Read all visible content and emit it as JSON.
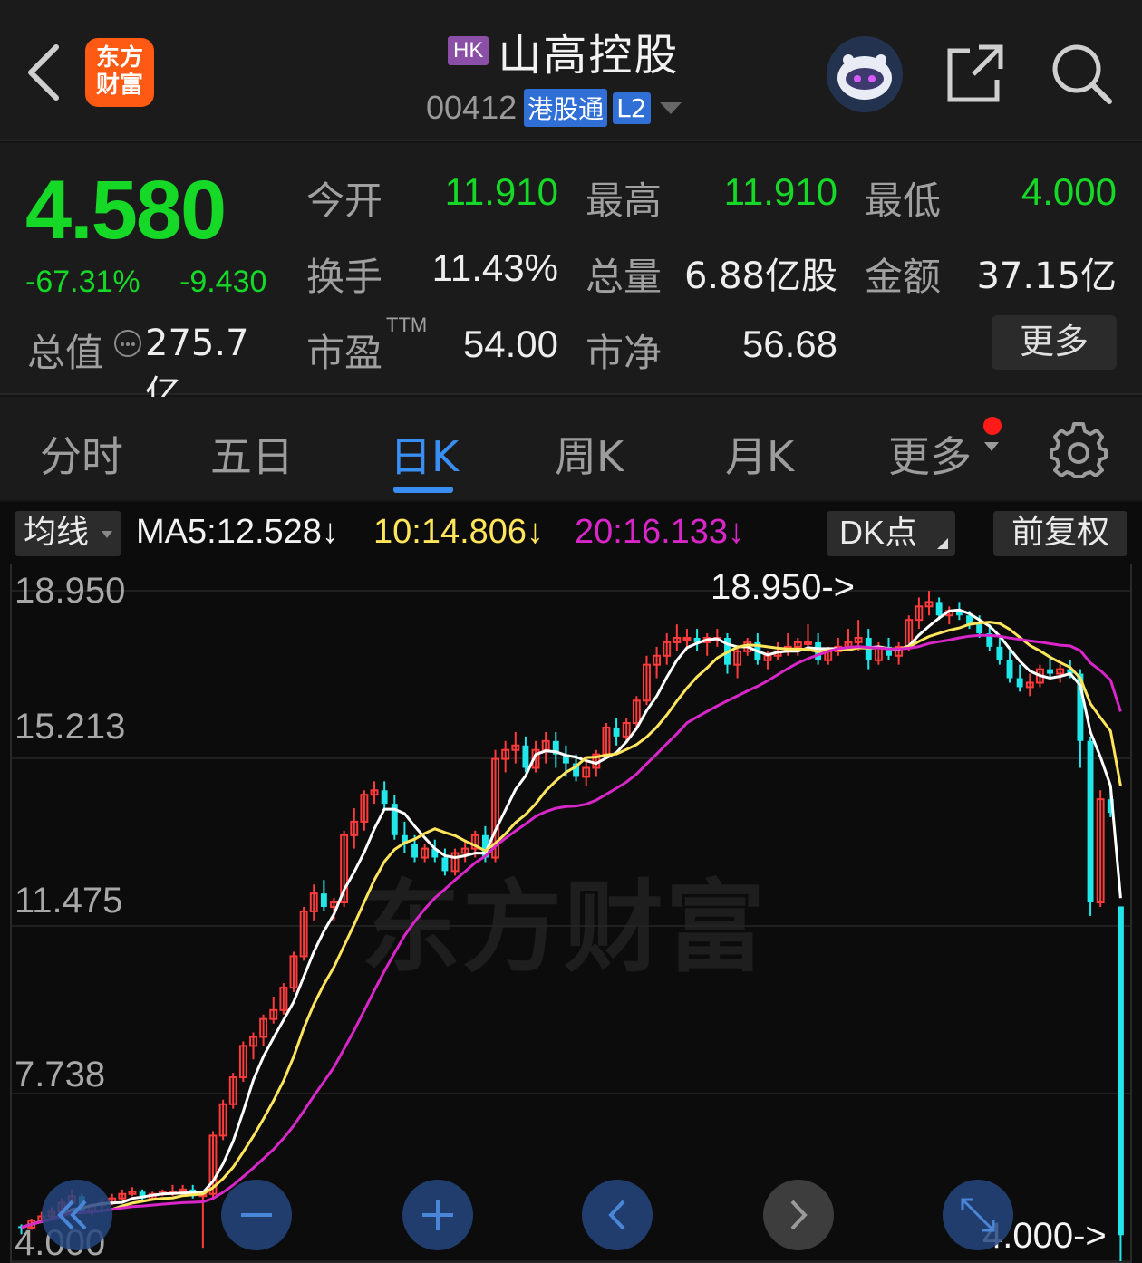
{
  "header": {
    "logo_line1": "东方",
    "logo_line2": "财富",
    "market_badge": "HK",
    "stock_name": "山高控股",
    "stock_code": "00412",
    "connect_badge": "港股通",
    "level_badge": "L2"
  },
  "quote": {
    "price": "4.580",
    "change_pct": "-67.31%",
    "change_val": "-9.430",
    "open_label": "今开",
    "open_value": "11.910",
    "high_label": "最高",
    "high_value": "11.910",
    "low_label": "最低",
    "low_value": "4.000",
    "turnover_label": "换手",
    "turnover_value": "11.43%",
    "volume_label": "总量",
    "volume_value": "6.88亿股",
    "amount_label": "金额",
    "amount_value": "37.15亿",
    "mktcap_label": "总值",
    "mktcap_value": "275.7亿",
    "pe_label": "市盈",
    "pe_sup": "TTM",
    "pe_value": "54.00",
    "pb_label": "市净",
    "pb_value": "56.68",
    "more_label": "更多"
  },
  "tabs": [
    "分时",
    "五日",
    "日K",
    "周K",
    "月K",
    "更多"
  ],
  "chart_toolbar": {
    "ma_select": "均线",
    "ma5": "MA5:12.528↓",
    "ma10": "10:14.806↓",
    "ma20": "20:16.133↓",
    "dk_button": "DK点",
    "adjust_button": "前复权"
  },
  "chart_labels": {
    "y_ticks": [
      "18.950",
      "15.213",
      "11.475",
      "7.738",
      "4.000"
    ],
    "high_marker": "18.950->",
    "low_marker": "4.000->",
    "watermark": "东方财富"
  },
  "colors": {
    "up": "#ff3b3b",
    "down": "#21e6ea",
    "ma5": "#ffffff",
    "ma10": "#ffe55c",
    "ma20": "#d926c9",
    "price_down": "#15d926",
    "accent": "#3a8ff5"
  },
  "controls": [
    "double-left-icon",
    "zoom-out-icon",
    "zoom-in-icon",
    "left-icon",
    "right-icon",
    "expand-icon"
  ],
  "chart_data": {
    "type": "candlestick",
    "ylim": [
      4.0,
      18.95
    ],
    "y_ticks": [
      18.95,
      15.213,
      11.475,
      7.738,
      4.0
    ],
    "candles_ohlc_approx": [
      [
        4.78,
        4.82,
        4.6,
        4.75
      ],
      [
        4.75,
        4.95,
        4.7,
        4.9
      ],
      [
        4.9,
        5.1,
        4.85,
        5.0
      ],
      [
        5.0,
        5.2,
        4.95,
        5.1
      ],
      [
        5.1,
        5.4,
        5.0,
        5.3
      ],
      [
        5.3,
        5.6,
        5.25,
        5.45
      ],
      [
        5.45,
        5.5,
        5.05,
        5.1
      ],
      [
        5.1,
        5.3,
        5.0,
        5.25
      ],
      [
        5.25,
        5.4,
        5.15,
        5.3
      ],
      [
        5.3,
        5.5,
        5.25,
        5.4
      ],
      [
        5.4,
        5.6,
        5.35,
        5.5
      ],
      [
        5.5,
        5.65,
        5.45,
        5.55
      ],
      [
        5.55,
        5.6,
        5.35,
        5.4
      ],
      [
        5.4,
        5.55,
        5.35,
        5.5
      ],
      [
        5.5,
        5.6,
        5.45,
        5.55
      ],
      [
        5.55,
        5.7,
        5.45,
        5.55
      ],
      [
        5.55,
        5.7,
        5.5,
        5.6
      ],
      [
        5.6,
        5.7,
        5.4,
        5.45
      ],
      [
        5.45,
        5.55,
        4.3,
        5.5
      ],
      [
        5.5,
        6.9,
        5.4,
        6.8
      ],
      [
        6.8,
        7.6,
        6.7,
        7.5
      ],
      [
        7.5,
        8.2,
        7.4,
        8.1
      ],
      [
        8.1,
        8.9,
        8.0,
        8.8
      ],
      [
        8.8,
        9.1,
        8.5,
        9.0
      ],
      [
        9.0,
        9.5,
        8.8,
        9.4
      ],
      [
        9.4,
        9.9,
        9.3,
        9.6
      ],
      [
        9.6,
        10.2,
        9.5,
        10.1
      ],
      [
        10.1,
        10.9,
        10.0,
        10.8
      ],
      [
        10.8,
        11.9,
        10.7,
        11.8
      ],
      [
        11.8,
        12.4,
        11.6,
        12.2
      ],
      [
        12.2,
        12.5,
        11.8,
        11.9
      ],
      [
        11.9,
        12.1,
        11.6,
        12.0
      ],
      [
        12.0,
        13.6,
        11.9,
        13.5
      ],
      [
        13.5,
        14.1,
        13.2,
        13.8
      ],
      [
        13.8,
        14.5,
        13.6,
        14.4
      ],
      [
        14.4,
        14.7,
        14.2,
        14.5
      ],
      [
        14.5,
        14.7,
        14.1,
        14.2
      ],
      [
        14.2,
        14.4,
        13.4,
        13.5
      ],
      [
        13.5,
        13.8,
        13.1,
        13.3
      ],
      [
        13.3,
        13.5,
        12.9,
        13.0
      ],
      [
        13.0,
        13.3,
        12.9,
        13.2
      ],
      [
        13.2,
        13.4,
        12.9,
        13.0
      ],
      [
        13.0,
        13.2,
        12.6,
        12.7
      ],
      [
        12.7,
        13.2,
        12.6,
        13.1
      ],
      [
        13.1,
        13.4,
        12.9,
        13.2
      ],
      [
        13.2,
        13.6,
        13.0,
        13.5
      ],
      [
        13.5,
        13.7,
        12.9,
        13.0
      ],
      [
        13.0,
        15.4,
        12.9,
        15.2
      ],
      [
        15.2,
        15.6,
        14.9,
        15.4
      ],
      [
        15.4,
        15.8,
        15.1,
        15.5
      ],
      [
        15.5,
        15.7,
        14.9,
        15.0
      ],
      [
        15.0,
        15.6,
        14.9,
        15.4
      ],
      [
        15.4,
        15.8,
        15.1,
        15.6
      ],
      [
        15.6,
        15.8,
        15.0,
        15.3
      ],
      [
        15.3,
        15.5,
        14.8,
        15.1
      ],
      [
        15.1,
        15.3,
        14.7,
        14.8
      ],
      [
        14.8,
        15.2,
        14.6,
        15.0
      ],
      [
        15.0,
        15.4,
        14.8,
        15.3
      ],
      [
        15.3,
        16.0,
        15.2,
        15.9
      ],
      [
        15.9,
        16.1,
        15.5,
        15.7
      ],
      [
        15.7,
        16.1,
        15.6,
        16.0
      ],
      [
        16.0,
        16.6,
        15.9,
        16.5
      ],
      [
        16.5,
        17.5,
        16.4,
        17.3
      ],
      [
        17.3,
        17.7,
        17.0,
        17.5
      ],
      [
        17.5,
        18.0,
        17.3,
        17.8
      ],
      [
        17.8,
        18.2,
        17.6,
        17.9
      ],
      [
        17.9,
        18.1,
        17.7,
        17.9
      ],
      [
        17.9,
        18.1,
        17.6,
        17.8
      ],
      [
        17.8,
        18.0,
        17.5,
        17.9
      ],
      [
        17.9,
        18.1,
        17.7,
        17.9
      ],
      [
        17.9,
        18.0,
        17.1,
        17.3
      ],
      [
        17.3,
        17.7,
        17.0,
        17.6
      ],
      [
        17.6,
        17.9,
        17.5,
        17.8
      ],
      [
        17.8,
        18.0,
        17.3,
        17.4
      ],
      [
        17.4,
        17.6,
        17.2,
        17.5
      ],
      [
        17.5,
        17.8,
        17.4,
        17.6
      ],
      [
        17.6,
        18.0,
        17.5,
        17.7
      ],
      [
        17.7,
        17.9,
        17.5,
        17.8
      ],
      [
        17.8,
        18.2,
        17.6,
        17.8
      ],
      [
        17.8,
        18.0,
        17.3,
        17.4
      ],
      [
        17.4,
        17.7,
        17.3,
        17.6
      ],
      [
        17.6,
        17.9,
        17.5,
        17.7
      ],
      [
        17.7,
        18.1,
        17.6,
        17.8
      ],
      [
        17.8,
        18.3,
        17.6,
        17.9
      ],
      [
        17.9,
        18.1,
        17.2,
        17.4
      ],
      [
        17.4,
        17.8,
        17.3,
        17.7
      ],
      [
        17.7,
        17.9,
        17.4,
        17.5
      ],
      [
        17.5,
        17.8,
        17.3,
        17.7
      ],
      [
        17.7,
        18.4,
        17.6,
        18.3
      ],
      [
        18.3,
        18.8,
        18.1,
        18.6
      ],
      [
        18.6,
        18.95,
        18.4,
        18.7
      ],
      [
        18.7,
        18.8,
        18.3,
        18.4
      ],
      [
        18.4,
        18.6,
        18.2,
        18.5
      ],
      [
        18.5,
        18.7,
        18.3,
        18.4
      ],
      [
        18.4,
        18.5,
        18.1,
        18.2
      ],
      [
        18.2,
        18.4,
        17.9,
        18.0
      ],
      [
        18.0,
        18.2,
        17.6,
        17.7
      ],
      [
        17.7,
        17.9,
        17.3,
        17.4
      ],
      [
        17.4,
        17.6,
        16.9,
        17.0
      ],
      [
        17.0,
        17.3,
        16.7,
        16.8
      ],
      [
        16.8,
        17.1,
        16.6,
        16.9
      ],
      [
        16.9,
        17.3,
        16.8,
        17.2
      ],
      [
        17.2,
        17.5,
        17.0,
        17.1
      ],
      [
        17.1,
        17.3,
        16.9,
        17.2
      ],
      [
        17.2,
        17.4,
        17.0,
        17.1
      ],
      [
        17.1,
        17.2,
        15.0,
        15.6
      ],
      [
        15.6,
        15.7,
        11.7,
        12.0
      ],
      [
        12.0,
        14.5,
        11.9,
        14.3
      ],
      [
        14.3,
        14.6,
        13.9,
        14.0
      ],
      [
        11.91,
        11.91,
        4.0,
        4.58
      ]
    ],
    "series": [
      {
        "name": "MA5",
        "final_value": 12.528
      },
      {
        "name": "10",
        "final_value": 14.806
      },
      {
        "name": "20",
        "final_value": 16.133
      }
    ],
    "high_marker": 18.95,
    "low_marker": 4.0
  }
}
